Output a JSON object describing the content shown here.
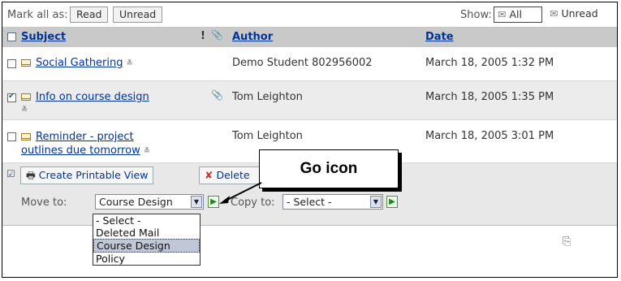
{
  "markbar": {
    "label": "Mark all as:",
    "read": "Read",
    "unread": "Unread"
  },
  "show": {
    "label": "Show:",
    "all": "All",
    "unread": "Unread"
  },
  "columns": {
    "subject": "Subject",
    "important": "!",
    "author": "Author",
    "date": "Date"
  },
  "messages": [
    {
      "subject": "Social Gathering",
      "author": "Demo Student 802956002",
      "date": "March 18, 2005 1:32 PM",
      "checked": false,
      "attachment": false
    },
    {
      "subject": "Info on course design",
      "author": "Tom Leighton",
      "date": "March 18, 2005 1:35 PM",
      "checked": true,
      "attachment": true
    },
    {
      "subject_line1": "Reminder - project",
      "subject_line2": "outlines due tomorrow",
      "author": "Tom Leighton",
      "date": "March 18, 2005 3:01 PM",
      "checked": false,
      "attachment": false
    }
  ],
  "actions": {
    "printable": "Create Printable View",
    "delete": "Delete",
    "move_label": "Move to:",
    "move_value": "Course Design",
    "copy_label": "Copy to:",
    "copy_value": "- Select -"
  },
  "move_options": [
    "- Select -",
    "Deleted Mail",
    "Course Design",
    "Policy"
  ],
  "callout": "Go icon",
  "icons": [
    "checkbox-icon",
    "envelope-icon",
    "thread-icon",
    "paperclip-icon",
    "printer-icon",
    "delete-icon",
    "go-arrow-icon",
    "copy-page-icon"
  ]
}
